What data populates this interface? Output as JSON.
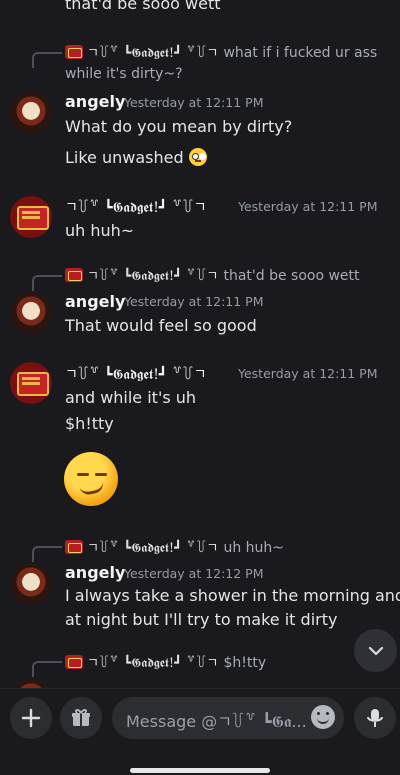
{
  "top_partial": {
    "text": "that'd be sooo wett"
  },
  "messages": [
    {
      "reply": {
        "name": "ㄱ꒦꒷ ┗𝕲𝖆𝖉𝖌𝖊𝖙!┛ ꒷꒦ㄱ",
        "text": "what if i fucked ur ass",
        "text2": "while it's dirty~?"
      },
      "author": "angely",
      "timestamp": "Yesterday at 12:11 PM",
      "lines": [
        "What do you mean by dirty?",
        "Like unwashed"
      ]
    },
    {
      "author": "ㄱ꒦꒷ ┗𝕲𝖆𝖉𝖌𝖊𝖙!┛ ꒷꒦ㄱ",
      "timestamp": "Yesterday at 12:11 PM",
      "lines": [
        "uh huh~"
      ]
    },
    {
      "reply": {
        "name": "ㄱ꒦꒷ ┗𝕲𝖆𝖉𝖌𝖊𝖙!┛ ꒷꒦ㄱ",
        "text": "that'd be sooo wett"
      },
      "author": "angely",
      "timestamp": "Yesterday at 12:11 PM",
      "lines": [
        "That would feel so good"
      ]
    },
    {
      "author": "ㄱ꒦꒷ ┗𝕲𝖆𝖉𝖌𝖊𝖙!┛ ꒷꒦ㄱ",
      "timestamp": "Yesterday at 12:11 PM",
      "lines": [
        "and while it's uh",
        "$h!tty"
      ]
    },
    {
      "reply": {
        "name": "ㄱ꒦꒷ ┗𝕲𝖆𝖉𝖌𝖊𝖙!┛ ꒷꒦ㄱ",
        "text": "uh huh~"
      },
      "author": "angely",
      "timestamp": "Yesterday at 12:12 PM",
      "lines": [
        "I always take a shower in the morning and",
        "at night but I'll try  to make it dirty"
      ]
    },
    {
      "reply": {
        "name": "ㄱ꒦꒷ ┗𝕲𝖆𝖉𝖌𝖊𝖙!┛ ꒷꒦ㄱ",
        "text": "$h!tty"
      }
    }
  ],
  "composer": {
    "placeholder": "Message @ㄱ꒦꒷ ┗𝕲𝖆..."
  },
  "icons": [
    "plus-icon",
    "gift-icon",
    "emoji-icon",
    "microphone-icon",
    "chevron-down-icon"
  ]
}
